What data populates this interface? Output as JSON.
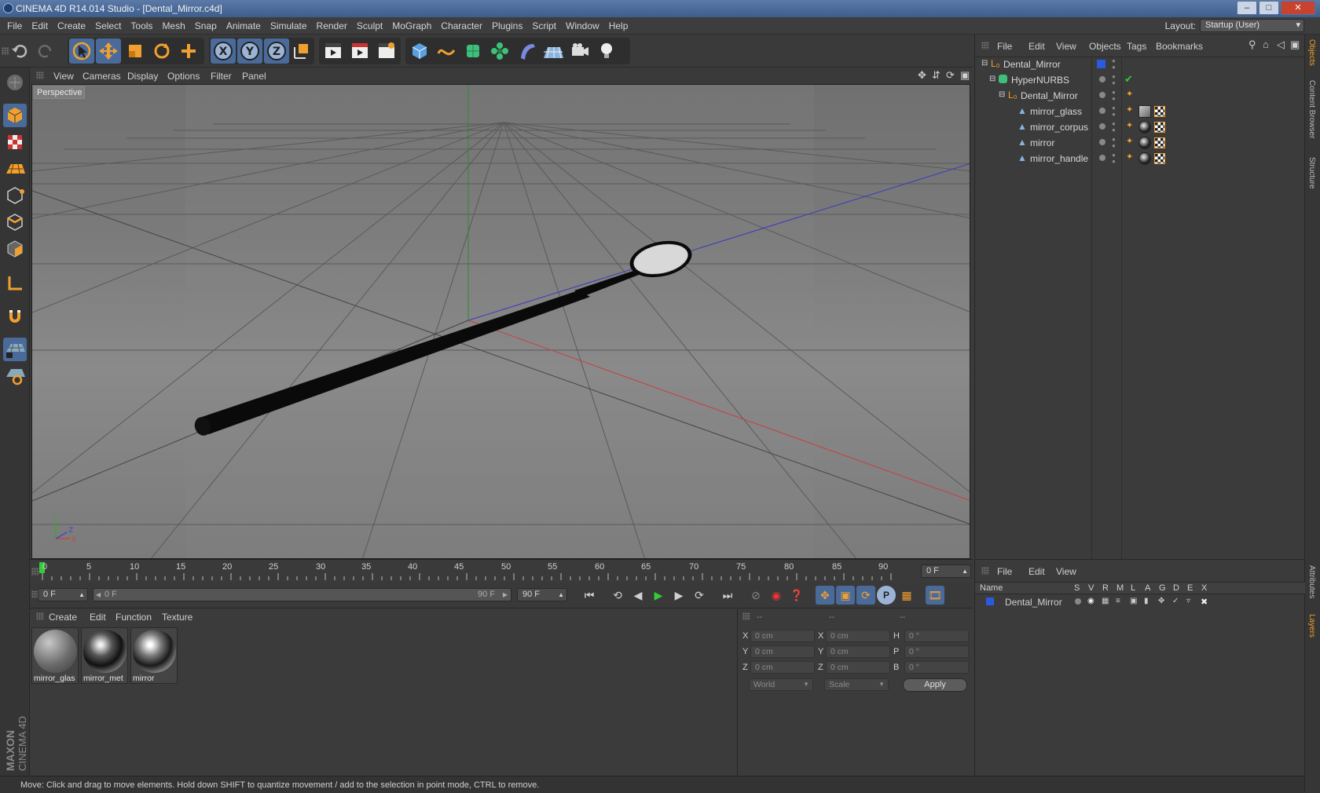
{
  "window": {
    "title": "CINEMA 4D R14.014 Studio - [Dental_Mirror.c4d]",
    "min": "–",
    "max": "□",
    "close": "✕"
  },
  "menubar": {
    "items": [
      "File",
      "Edit",
      "Create",
      "Select",
      "Tools",
      "Mesh",
      "Snap",
      "Animate",
      "Simulate",
      "Render",
      "Sculpt",
      "MoGraph",
      "Character",
      "Plugins",
      "Script",
      "Window",
      "Help"
    ],
    "layout_label": "Layout:",
    "layout_value": "Startup (User)"
  },
  "viewport": {
    "menu": [
      "View",
      "Cameras",
      "Display",
      "Options",
      "Filter",
      "Panel"
    ],
    "label": "Perspective"
  },
  "objects_panel": {
    "menu": [
      "File",
      "Edit",
      "View",
      "Objects",
      "Tags",
      "Bookmarks"
    ],
    "rows": [
      {
        "name": "Dental_Mirror"
      },
      {
        "name": "HyperNURBS"
      },
      {
        "name": "Dental_Mirror"
      },
      {
        "name": "mirror_glass"
      },
      {
        "name": "mirror_corpus"
      },
      {
        "name": "mirror"
      },
      {
        "name": "mirror_handle"
      }
    ]
  },
  "side_tabs": [
    "Objects",
    "Content Browser",
    "Structure",
    "Attributes",
    "Layers"
  ],
  "timeline": {
    "ticks": [
      "0",
      "5",
      "10",
      "15",
      "20",
      "25",
      "30",
      "35",
      "40",
      "45",
      "50",
      "55",
      "60",
      "65",
      "70",
      "75",
      "80",
      "85",
      "90"
    ],
    "current": "0 F"
  },
  "transport": {
    "start": "0 F",
    "range_start": "0 F",
    "range_end": "90 F",
    "end": "90 F"
  },
  "materials": {
    "menu": [
      "Create",
      "Edit",
      "Function",
      "Texture"
    ],
    "items": [
      {
        "name": "mirror_glas"
      },
      {
        "name": "mirror_met"
      },
      {
        "name": "mirror"
      }
    ]
  },
  "coords": {
    "headers": [
      "--",
      "--",
      "--"
    ],
    "rows": [
      {
        "a": "X",
        "v1": "0 cm",
        "b": "X",
        "v2": "0 cm",
        "c": "H",
        "v3": "0 °"
      },
      {
        "a": "Y",
        "v1": "0 cm",
        "b": "Y",
        "v2": "0 cm",
        "c": "P",
        "v3": "0 °"
      },
      {
        "a": "Z",
        "v1": "0 cm",
        "b": "Z",
        "v2": "0 cm",
        "c": "B",
        "v3": "0 °"
      }
    ],
    "world": "World",
    "scale": "Scale",
    "apply": "Apply"
  },
  "layers": {
    "menu": [
      "File",
      "Edit",
      "View"
    ],
    "col_name": "Name",
    "cols": [
      "S",
      "V",
      "R",
      "M",
      "L",
      "A",
      "G",
      "D",
      "E",
      "X"
    ],
    "row": "Dental_Mirror"
  },
  "status": "Move: Click and drag to move elements. Hold down SHIFT to quantize movement / add to the selection in point mode, CTRL to remove.",
  "colors": {
    "accent": "#f0a030",
    "layer_blue": "#2a5ae0",
    "grid": "#4a4a4a"
  }
}
